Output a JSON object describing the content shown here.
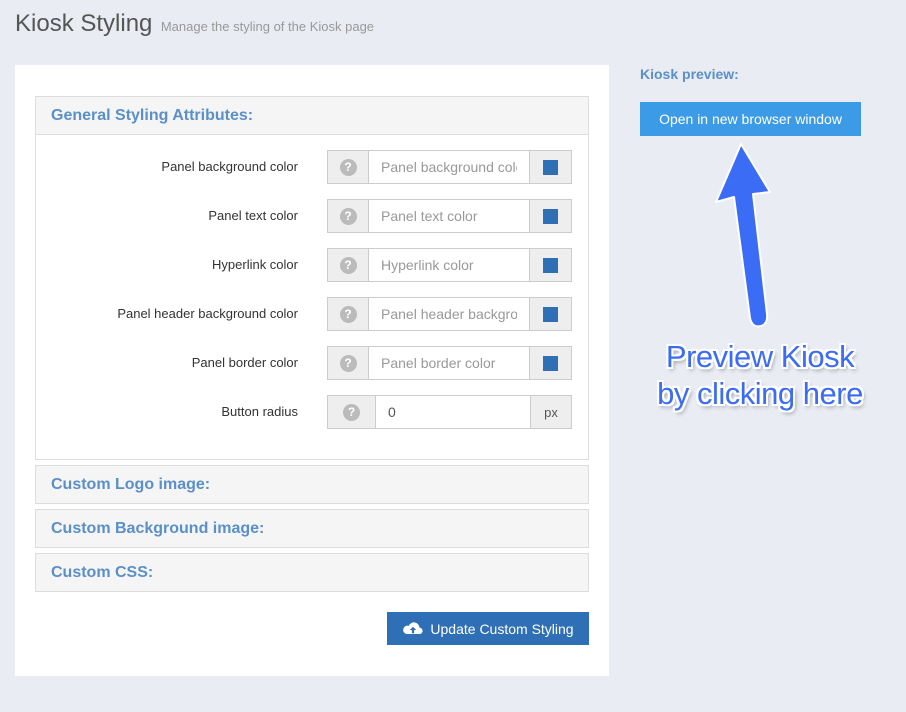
{
  "header": {
    "title": "Kiosk Styling",
    "subtitle": "Manage the styling of the Kiosk page"
  },
  "general": {
    "heading": "General Styling Attributes:",
    "fields": [
      {
        "label": "Panel background color",
        "placeholder": "Panel background color",
        "value": ""
      },
      {
        "label": "Panel text color",
        "placeholder": "Panel text color",
        "value": ""
      },
      {
        "label": "Hyperlink color",
        "placeholder": "Hyperlink color",
        "value": ""
      },
      {
        "label": "Panel header background color",
        "placeholder": "Panel header background color",
        "value": ""
      },
      {
        "label": "Panel border color",
        "placeholder": "Panel border color",
        "value": ""
      }
    ],
    "radius": {
      "label": "Button radius",
      "value": "0",
      "unit": "px"
    },
    "help_glyph": "?"
  },
  "sections": {
    "logo": "Custom Logo image:",
    "background": "Custom Background image:",
    "css": "Custom CSS:"
  },
  "actions": {
    "update_label": "Update Custom Styling",
    "update_icon": "cloud-upload-icon"
  },
  "preview": {
    "label": "Kiosk preview:",
    "open_label": "Open in new browser window"
  },
  "annotation": {
    "line1": "Preview Kiosk",
    "line2": "by clicking here"
  },
  "colors": {
    "accent": "#5b8fc7",
    "primary_button": "#2f6fb5",
    "preview_button": "#3c9be6",
    "swatch": "#2f6fb5",
    "annotation": "#3b6cf5"
  }
}
